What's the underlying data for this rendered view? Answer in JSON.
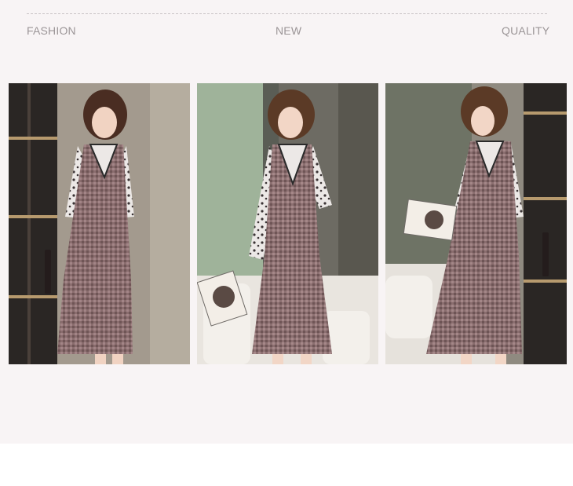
{
  "header": {
    "left": "FASHION",
    "center": "NEW",
    "right": "QUALITY"
  },
  "photos": [
    {
      "name": "model-photo-1"
    },
    {
      "name": "model-photo-2"
    },
    {
      "name": "model-photo-3"
    }
  ],
  "colors": {
    "panel_bg": "#f8f4f5",
    "label": "#9b9597",
    "dress": "#8a6d6e",
    "shirt": "#e9e5e3"
  }
}
